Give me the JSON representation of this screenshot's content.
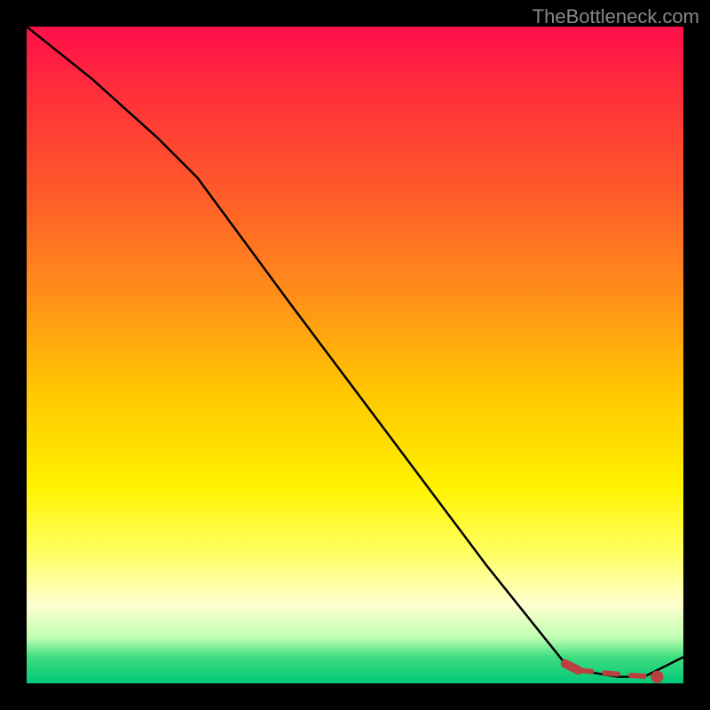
{
  "watermark": "TheBottleneck.com",
  "chart_data": {
    "type": "line",
    "title": "",
    "xlabel": "",
    "ylabel": "",
    "xlim": [
      0,
      100
    ],
    "ylim": [
      0,
      100
    ],
    "series": [
      {
        "name": "bottleneck-curve",
        "x": [
          0,
          10,
          20,
          26,
          40,
          55,
          70,
          82,
          84,
          90,
          94,
          100
        ],
        "y": [
          100,
          92,
          83,
          77,
          58,
          38,
          18,
          3,
          2,
          1,
          1,
          4
        ]
      },
      {
        "name": "optimal-band-solid",
        "x": [
          82,
          84
        ],
        "y": [
          3,
          2
        ]
      },
      {
        "name": "optimal-band-dashed",
        "x": [
          84,
          86,
          88,
          90,
          92,
          94,
          96
        ],
        "y": [
          2,
          1.8,
          1.6,
          1.4,
          1.2,
          1.1,
          1
        ]
      },
      {
        "name": "optimal-point",
        "x": [
          96
        ],
        "y": [
          1
        ]
      }
    ],
    "grid": false,
    "legend": false
  }
}
